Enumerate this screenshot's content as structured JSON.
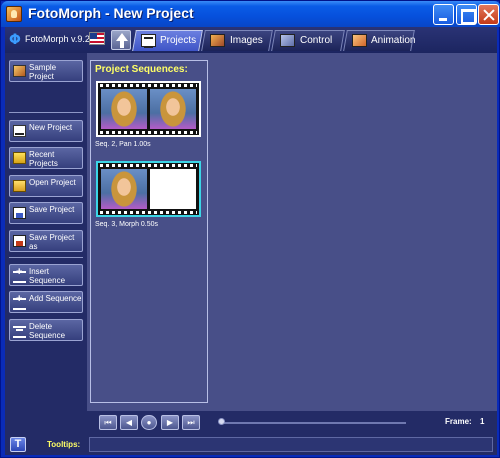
{
  "window": {
    "title": "FotoMorph - New Project",
    "title_icon": "fotomorph-app-icon",
    "buttons": [
      "minimize-icon",
      "maximize-icon",
      "close-icon"
    ]
  },
  "header": {
    "logo_glyph": "Φ",
    "version": "FotoMorph v.9.2.",
    "tabs": [
      {
        "label": "Projects",
        "icon": "projects-filmstrip-icon",
        "active": true
      },
      {
        "label": "Images",
        "icon": "images-icon",
        "active": false
      },
      {
        "label": "Control",
        "icon": "control-icon",
        "active": false
      },
      {
        "label": "Animation",
        "icon": "animation-icon",
        "active": false
      }
    ]
  },
  "sidebar": {
    "buttons": [
      {
        "label": "Sample Project",
        "icon": "sample-project-icon"
      },
      {
        "label": "New Project",
        "icon": "new-project-icon"
      },
      {
        "label": "Recent Projects",
        "icon": "recent-projects-icon"
      },
      {
        "label": "Open Project",
        "icon": "open-folder-icon"
      },
      {
        "label": "Save Project",
        "icon": "save-icon"
      },
      {
        "label": "Save Project as",
        "icon": "save-as-icon"
      },
      {
        "label": "Insert Sequence",
        "icon": "insert-sequence-icon"
      },
      {
        "label": "Add Sequence",
        "icon": "add-sequence-icon"
      },
      {
        "label": "Delete Sequence",
        "icon": "delete-sequence-icon"
      }
    ]
  },
  "sequences": {
    "title": "Project Sequences:",
    "items": [
      {
        "caption": "Seq. 2,  Pan 1.00s",
        "frames": [
          "portrait",
          "portrait"
        ],
        "selected": false
      },
      {
        "caption": "Seq. 3,  Morph 0.50s",
        "frames": [
          "portrait",
          "blank"
        ],
        "selected": true
      }
    ]
  },
  "player": {
    "buttons": [
      "first-frame-icon",
      "previous-frame-icon",
      "play-icon",
      "next-frame-icon",
      "last-frame-icon"
    ],
    "glyphs": [
      "⏮",
      "◀",
      "●",
      "▶",
      "⏭"
    ],
    "frame_label": "Frame:",
    "frame_value": "1"
  },
  "tooltips": {
    "button_label": "T",
    "label": "Tooltips:",
    "text": ""
  },
  "colors": {
    "accent_yellow": "#ffff66",
    "panel_bg": "#484f88",
    "selected_border": "#3bd5e6"
  }
}
